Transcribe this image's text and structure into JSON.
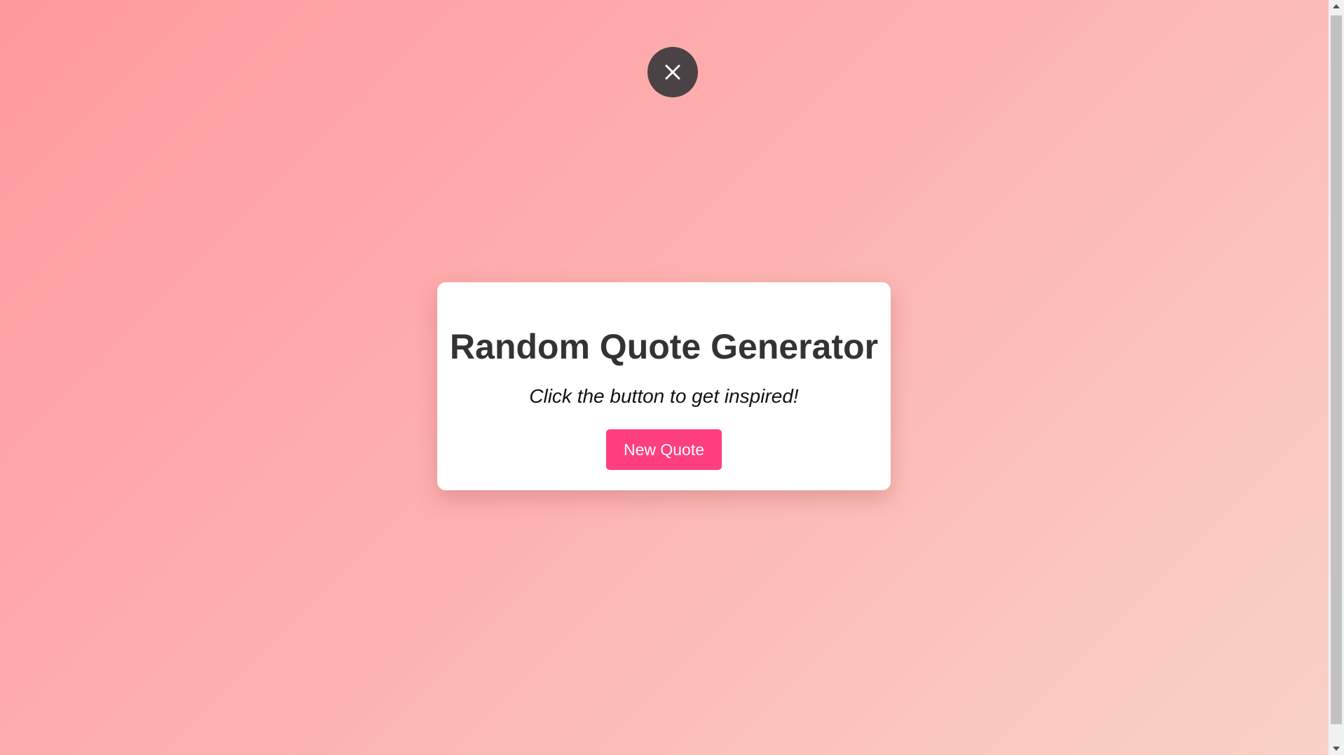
{
  "app": {
    "title": "Random Quote Generator",
    "subtitle": "Click the button to get inspired!",
    "button_label": "New Quote"
  },
  "icons": {
    "close": "close-icon",
    "scroll_up": "arrow-up-icon",
    "scroll_down": "arrow-down-icon"
  },
  "colors": {
    "background_start": "#ff9a9e",
    "background_end": "#f9d1c6",
    "close_button": "#4b4245",
    "card": "#ffffff",
    "title_text": "#333333",
    "button": "#ff3e7f",
    "button_text": "#ffffff"
  }
}
